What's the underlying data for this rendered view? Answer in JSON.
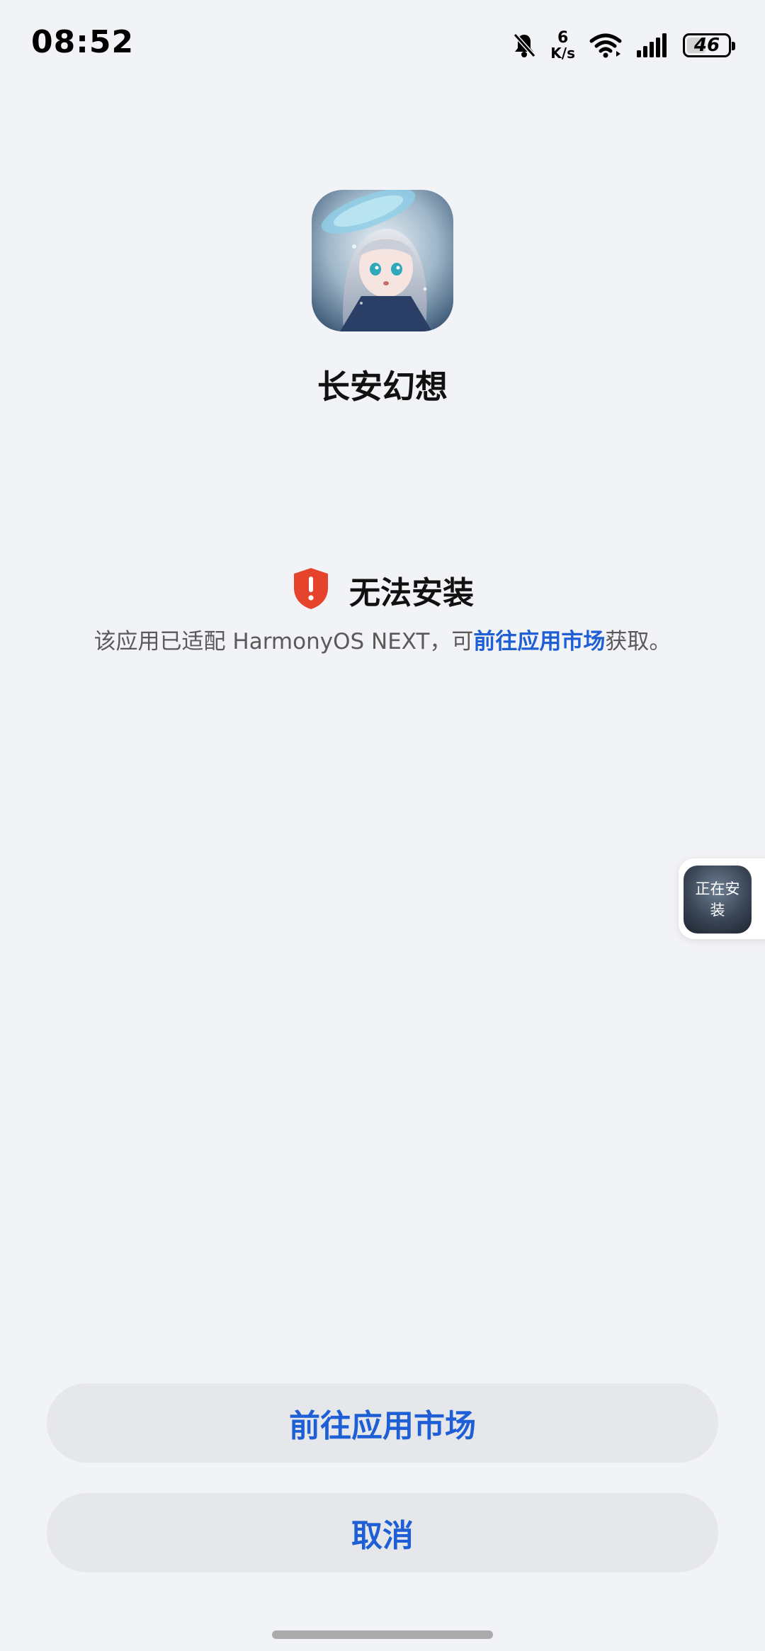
{
  "status_bar": {
    "time": "08:52",
    "net_speed_value": "6",
    "net_speed_unit": "K/s",
    "battery": "46",
    "battery_level": 0.46,
    "icons": [
      "bell-muted-icon",
      "wifi-icon",
      "signal-icon",
      "battery-icon"
    ]
  },
  "app": {
    "name": "长安幻想",
    "icon": "app-icon-anime-girl"
  },
  "error": {
    "icon": "shield-alert-icon",
    "icon_color": "#e5432b",
    "title": "无法安装",
    "desc_before": "该应用已适配 HarmonyOS NEXT，可",
    "desc_link": "前往应用市场",
    "desc_after": "获取。"
  },
  "floating": {
    "label": "正在安装"
  },
  "buttons": {
    "primary": "前往应用市场",
    "cancel": "取消"
  },
  "colors": {
    "accent": "#1f5fd6",
    "background": "#f2f3f6",
    "button_bg": "#e6e7ea"
  }
}
